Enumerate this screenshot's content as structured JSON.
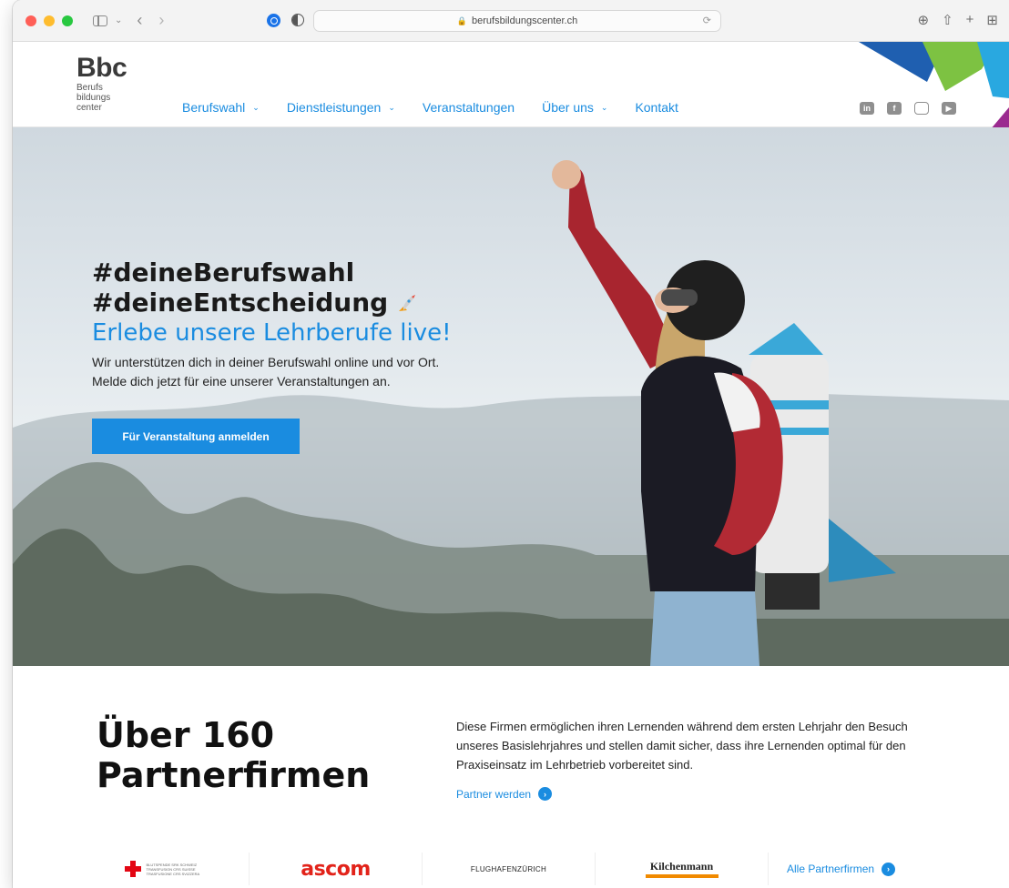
{
  "browser": {
    "url": "berufsbildungscenter.ch"
  },
  "site": {
    "logo_main": "Bbc",
    "logo_sub": [
      "Berufs",
      "bildungs",
      "center"
    ]
  },
  "nav": {
    "items": [
      {
        "label": "Berufswahl",
        "dropdown": true
      },
      {
        "label": "Dienstleistungen",
        "dropdown": true
      },
      {
        "label": "Veranstaltungen",
        "dropdown": false
      },
      {
        "label": "Über uns",
        "dropdown": true
      },
      {
        "label": "Kontakt",
        "dropdown": false
      }
    ],
    "social": [
      "linkedin-icon",
      "facebook-icon",
      "instagram-icon",
      "youtube-icon"
    ]
  },
  "hero": {
    "line1": "#deineBerufswahl",
    "line2": "#deineEntscheidung",
    "line3": "Erlebe unsere Lehrberufe live!",
    "body": "Wir unterstützen dich in deiner Berufswahl online und vor Ort. Melde dich jetzt für eine unserer Veranstaltungen an.",
    "cta": "Für Veranstaltung anmelden"
  },
  "partners": {
    "title_line1": "Über 160",
    "title_line2": "Partnerfirmen",
    "text": "Diese Firmen ermöglichen ihren Lernenden während dem ersten Lehrjahr den Besuch unseres Basislehrjahres und stellen damit sicher, dass ihre Lernenden optimal für den Praxiseinsatz im Lehrbetrieb vorbereitet sind.",
    "link": "Partner werden",
    "logos": {
      "redcross_text": "BLUTSPENDE SRK SCHWEIZ TRANSFUSION CRS SUISSE TRASFUSIONE CRS SVIZZERA",
      "ascom": "ascom",
      "flughafen": "FLUGHAFENZÜRICH",
      "kilchenmann": "Kilchenmann"
    },
    "all_link": "Alle Partnerfirmen"
  },
  "colors": {
    "accent": "#1a8ce0",
    "heading": "#1a1a1a"
  }
}
